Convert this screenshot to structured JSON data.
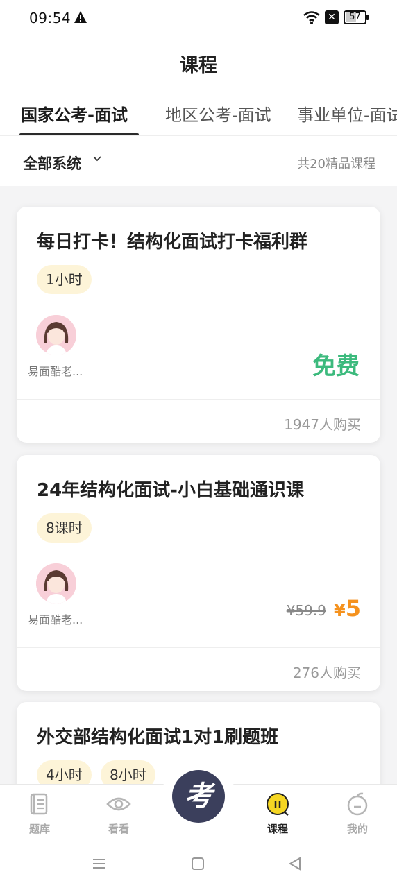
{
  "status_bar": {
    "time": "09:54",
    "sim": "✕",
    "battery": "57"
  },
  "page_title": "课程",
  "tabs": [
    {
      "label": "国家公考-面试",
      "active": true
    },
    {
      "label": "地区公考-面试",
      "active": false
    },
    {
      "label": "事业单位-面试",
      "active": false
    }
  ],
  "filter": {
    "label": "全部系统",
    "count_text": "共20精品课程"
  },
  "courses": [
    {
      "title": "每日打卡！结构化面试打卡福利群",
      "tags": [
        "1小时"
      ],
      "teacher": "易面酷老...",
      "price_label": "免费",
      "buyers": "1947人购买"
    },
    {
      "title": "24年结构化面试-小白基础通识课",
      "tags": [
        "8课时"
      ],
      "teacher": "易面酷老...",
      "original_price": "¥59.9",
      "currency": "¥",
      "price": "5",
      "buyers": "276人购买"
    },
    {
      "title": "外交部结构化面试1对1刷题班",
      "tags": [
        "4小时",
        "8小时"
      ]
    }
  ],
  "bottom_nav": [
    {
      "label": "题库",
      "icon": "question-bank-icon"
    },
    {
      "label": "看看",
      "icon": "eye-icon"
    },
    {
      "label": "考",
      "icon": "kao-logo-icon"
    },
    {
      "label": "课程",
      "icon": "course-icon",
      "active": true
    },
    {
      "label": "我的",
      "icon": "profile-icon"
    }
  ],
  "colors": {
    "free_green": "#3cba7d",
    "price_orange": "#f5921e",
    "tag_bg": "#fdf4d8",
    "center_btn": "#3b3f5c",
    "active_yellow": "#f5d623"
  }
}
